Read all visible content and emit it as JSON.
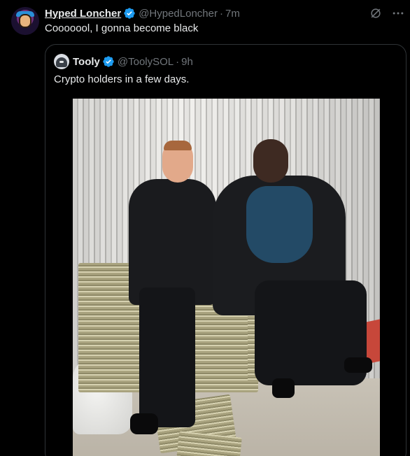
{
  "tweet": {
    "display_name": "Hyped Loncher",
    "handle": "@HypedLoncher",
    "separator": "·",
    "time": "7m",
    "text": "Cooooool, I gonna become black",
    "avatar_icon": "user-avatar"
  },
  "actions": {
    "grok_icon": "grok-icon",
    "more_icon": "more-icon"
  },
  "quote": {
    "display_name": "Tooly",
    "handle": "@ToolySOL",
    "separator": "·",
    "time": "9h",
    "text": "Crypto holders in a few days.",
    "avatar_icon": "user-avatar",
    "image": {
      "description_icon": "photo-two-men-sitting-on-cash-stacks"
    }
  },
  "colors": {
    "background": "#000000",
    "text_primary": "#e7e9ea",
    "text_secondary": "#71767b",
    "border": "#2f3336",
    "verified_blue": "#1d9bf0"
  }
}
